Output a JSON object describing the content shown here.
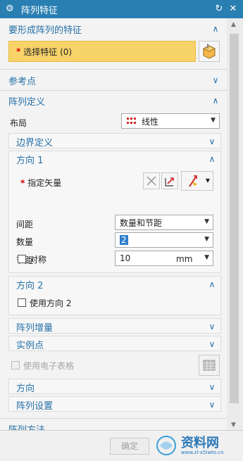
{
  "window": {
    "title": "阵列特征"
  },
  "sections": {
    "features": {
      "title": "要形成阵列的特征",
      "select_label": "选择特征 (0)"
    },
    "reference": {
      "title": "参考点"
    },
    "definition": {
      "title": "阵列定义",
      "layout_label": "布局",
      "layout_value": "线性",
      "boundary_title": "边界定义",
      "dir1": {
        "title": "方向 1",
        "vector_label": "指定矢量",
        "spacing_label": "间距",
        "spacing_value": "数量和节距",
        "count_label": "数量",
        "count_value": "2",
        "pitch_label": "节距",
        "pitch_value": "10",
        "pitch_unit": "mm",
        "symmetric_label": "对称"
      },
      "dir2": {
        "title": "方向 2",
        "use_label": "使用方向 2"
      },
      "increment_title": "阵列增量",
      "instances_title": "实例点",
      "spreadsheet_label": "使用电子表格",
      "direction_title": "方向",
      "settings_title": "阵列设置"
    },
    "method": {
      "title": "阵列方法"
    }
  },
  "footer": {
    "ok_label": "确定",
    "watermark": "资料网",
    "watermark_url": "www.zl-x5iwto.cn"
  },
  "colors": {
    "titlebar": "#2a7fb2",
    "header_text": "#2670a8",
    "selection": "#f7d36a",
    "required": "#d60000"
  },
  "icons": [
    "settings-icon",
    "reset-icon",
    "close-icon",
    "expand-chevron-icon",
    "collapse-chevron-icon",
    "feature-select-icon",
    "vector-icon",
    "spreadsheet-icon"
  ]
}
